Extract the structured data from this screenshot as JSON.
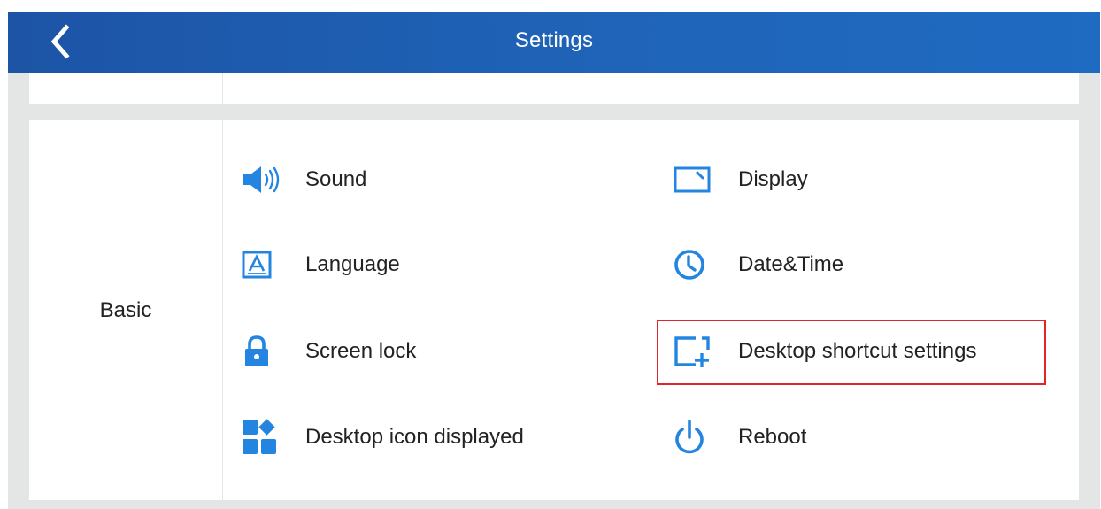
{
  "header": {
    "title": "Settings",
    "back_icon": "chevron-left-icon"
  },
  "section": {
    "label": "Basic"
  },
  "items": [
    {
      "label": "Sound",
      "icon": "speaker-icon"
    },
    {
      "label": "Display",
      "icon": "display-icon"
    },
    {
      "label": "Language",
      "icon": "language-icon"
    },
    {
      "label": "Date&Time",
      "icon": "clock-icon"
    },
    {
      "label": "Screen lock",
      "icon": "lock-icon"
    },
    {
      "label": "Desktop shortcut settings",
      "icon": "shortcut-add-icon"
    },
    {
      "label": "Desktop icon displayed",
      "icon": "apps-icon"
    },
    {
      "label": "Reboot",
      "icon": "power-icon"
    }
  ],
  "colors": {
    "header_bg": "#1f64b8",
    "icon_blue": "#2385e0",
    "highlight_border": "#e2222c",
    "background": "#e4e6e5"
  }
}
